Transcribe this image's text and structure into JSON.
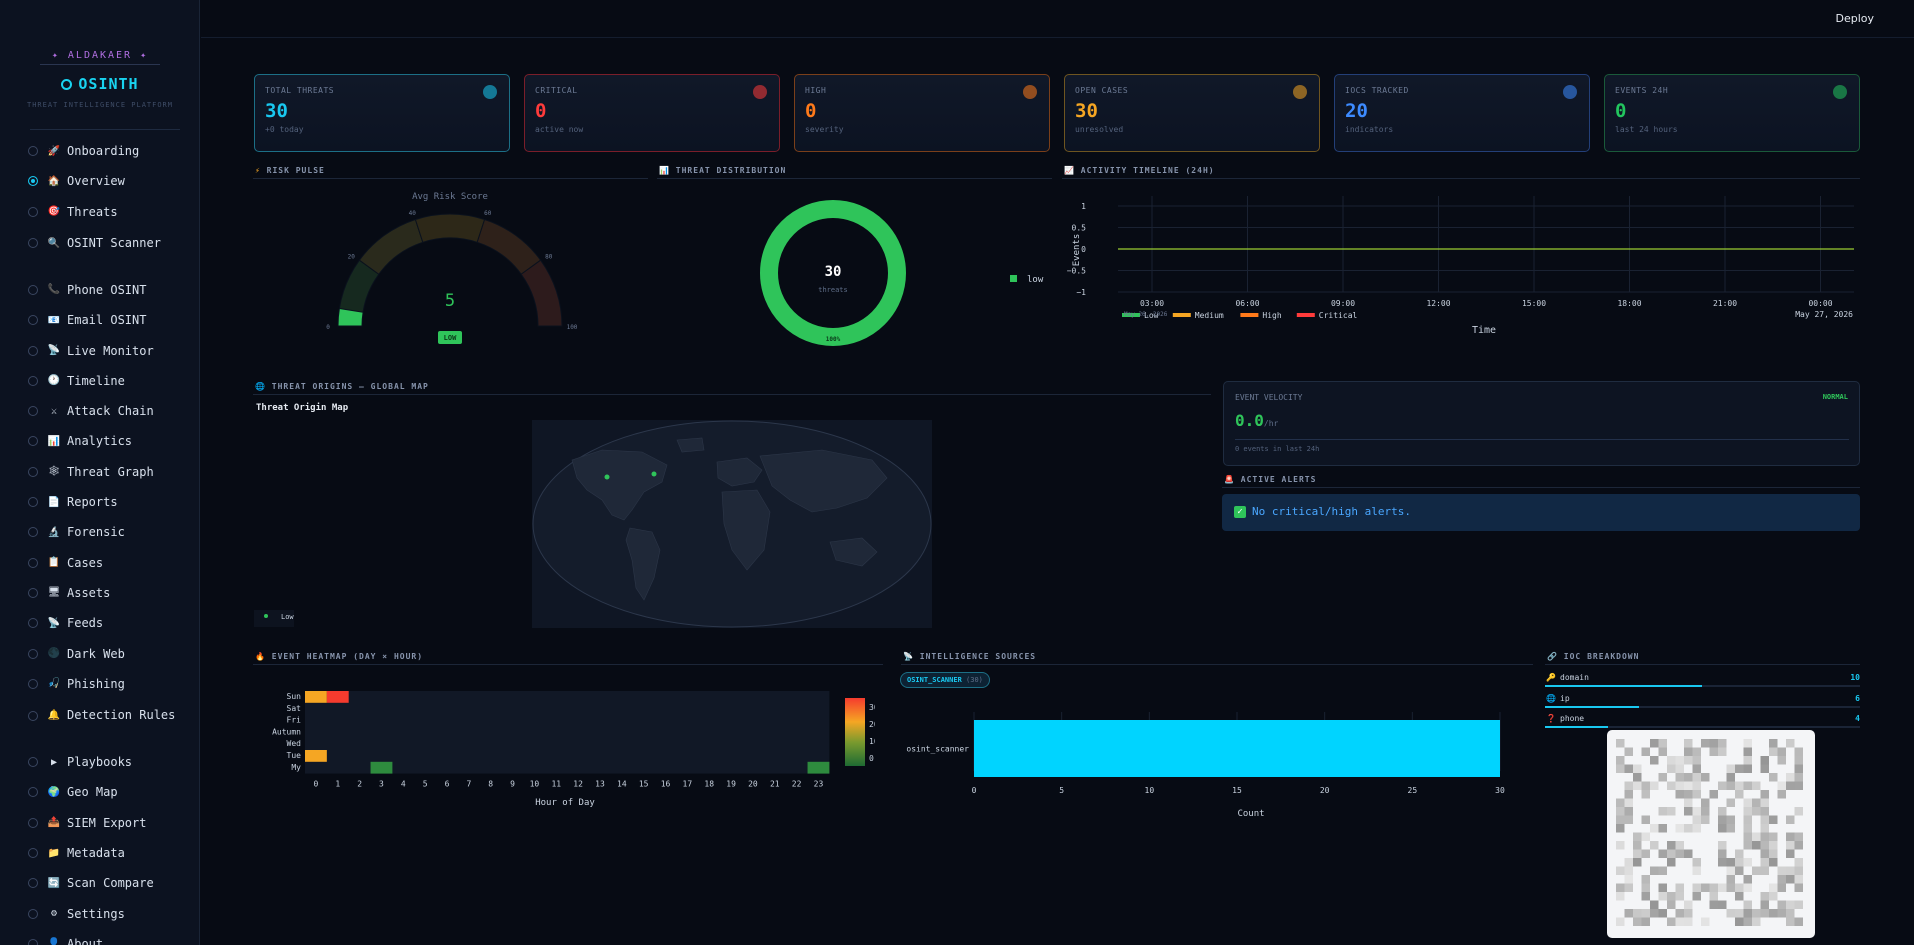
{
  "brand": {
    "tag": "✦ ALDAKAER ✦",
    "name": "OSINTH",
    "subtitle": "THREAT INTELLIGENCE PLATFORM"
  },
  "topbar": {
    "deploy": "Deploy"
  },
  "nav": [
    {
      "label": "Onboarding",
      "icon": "🚀"
    },
    {
      "label": "Overview",
      "icon": "🏠",
      "active": true
    },
    {
      "label": "Threats",
      "icon": "🎯"
    },
    {
      "label": "OSINT Scanner",
      "icon": "🔍"
    },
    {
      "label": "Phone OSINT",
      "icon": "📞"
    },
    {
      "label": "Email OSINT",
      "icon": "📧"
    },
    {
      "label": "Live Monitor",
      "icon": "📡"
    },
    {
      "label": "Timeline",
      "icon": "🕐"
    },
    {
      "label": "Attack Chain",
      "icon": "⚔"
    },
    {
      "label": "Analytics",
      "icon": "📊"
    },
    {
      "label": "Threat Graph",
      "icon": "🕸"
    },
    {
      "label": "Reports",
      "icon": "📄"
    },
    {
      "label": "Forensic",
      "icon": "🔬"
    },
    {
      "label": "Cases",
      "icon": "📋"
    },
    {
      "label": "Assets",
      "icon": "🖥"
    },
    {
      "label": "Feeds",
      "icon": "📡"
    },
    {
      "label": "Dark Web",
      "icon": "🌑"
    },
    {
      "label": "Phishing",
      "icon": "🎣"
    },
    {
      "label": "Detection Rules",
      "icon": "🔔"
    },
    {
      "label": "Playbooks",
      "icon": "▶"
    },
    {
      "label": "Geo Map",
      "icon": "🌍"
    },
    {
      "label": "SIEM Export",
      "icon": "📤"
    },
    {
      "label": "Metadata",
      "icon": "📁"
    },
    {
      "label": "Scan Compare",
      "icon": "🔄"
    },
    {
      "label": "Settings",
      "icon": "⚙"
    },
    {
      "label": "About",
      "icon": "👤"
    }
  ],
  "kpis": [
    {
      "label": "TOTAL THREATS",
      "value": "30",
      "sub": "+0 today",
      "color": "#19c8f0",
      "border": "#1c6f86"
    },
    {
      "label": "CRITICAL",
      "value": "0",
      "sub": "active now",
      "color": "#ff3b3b",
      "border": "#7a1e2a"
    },
    {
      "label": "HIGH",
      "value": "0",
      "sub": "severity",
      "color": "#ff7a1a",
      "border": "#7a3f1a"
    },
    {
      "label": "OPEN CASES",
      "value": "30",
      "sub": "unresolved",
      "color": "#f5a623",
      "border": "#6e5520"
    },
    {
      "label": "IOCS TRACKED",
      "value": "20",
      "sub": "indicators",
      "color": "#3d8bff",
      "border": "#233f78"
    },
    {
      "label": "EVENTS 24H",
      "value": "0",
      "sub": "last 24 hours",
      "color": "#22c55e",
      "border": "#1a5a3a"
    }
  ],
  "sections": {
    "risk_pulse": "RISK PULSE",
    "threat_distribution": "THREAT DISTRIBUTION",
    "activity_timeline": "ACTIVITY TIMELINE (24H)",
    "threat_origins": "THREAT ORIGINS — GLOBAL MAP",
    "active_alerts": "ACTIVE ALERTS",
    "event_heatmap": "EVENT HEATMAP (DAY × HOUR)",
    "intel_sources": "INTELLIGENCE SOURCES",
    "ioc_breakdown": "IOC BREAKDOWN"
  },
  "gauge": {
    "title": "Avg Risk Score",
    "value": 5,
    "badge": "LOW",
    "ticks": [
      "0",
      "20",
      "40",
      "60",
      "80",
      "100"
    ]
  },
  "donut": {
    "center_value": "30",
    "center_label": "threats",
    "pct_label": "100%",
    "legend": "low",
    "color": "#2fc45a"
  },
  "timeline": {
    "ylabel": "Events",
    "xlabel": "Time",
    "yticks": [
      "1",
      "0.5",
      "0",
      "−0.5",
      "−1"
    ],
    "xticks": [
      "03:00",
      "06:00",
      "09:00",
      "12:00",
      "15:00",
      "18:00",
      "21:00",
      "00:00"
    ],
    "date_left": "May 26, 2026",
    "date_right": "May 27, 2026",
    "legend": [
      "Low",
      "Medium",
      "High",
      "Critical"
    ]
  },
  "map": {
    "title": "Threat Origin Map",
    "legend": "Low"
  },
  "velocity": {
    "label": "EVENT VELOCITY",
    "status": "NORMAL",
    "value": "0.0",
    "unit": "/hr",
    "sub": "0 events in last 24h"
  },
  "alerts": {
    "message": "No critical/high alerts."
  },
  "chart_data": [
    {
      "type": "heatmap",
      "xlabel": "Hour of Day",
      "rows": [
        "Sun",
        "Sat",
        "Fri",
        "Autumn",
        "Wed",
        "Tue",
        "My"
      ],
      "x": [
        0,
        1,
        2,
        3,
        4,
        5,
        6,
        7,
        8,
        9,
        10,
        11,
        12,
        13,
        14,
        15,
        16,
        17,
        18,
        19,
        20,
        21,
        22,
        23
      ],
      "cells": [
        {
          "row": "Sun",
          "hour": 0,
          "value": 20
        },
        {
          "row": "Sun",
          "hour": 1,
          "value": 30
        },
        {
          "row": "Tue",
          "hour": 0,
          "value": 20
        },
        {
          "row": "My",
          "hour": 3,
          "value": 5
        },
        {
          "row": "My",
          "hour": 23,
          "value": 5
        }
      ],
      "colorbar_ticks": [
        "30",
        "20",
        "10",
        "0"
      ]
    },
    {
      "type": "bar",
      "orientation": "horizontal",
      "categories": [
        "osint_scanner"
      ],
      "values": [
        30
      ],
      "xlabel": "Count",
      "xlim": [
        0,
        30
      ],
      "xticks": [
        "0",
        "5",
        "10",
        "15",
        "20",
        "25",
        "30"
      ],
      "badge": "OSINT_SCANNER",
      "badge_count": "(30)"
    },
    {
      "type": "bar",
      "orientation": "horizontal",
      "categories": [
        "domain",
        "ip",
        "phone"
      ],
      "values": [
        10,
        6,
        4
      ],
      "icons": [
        "🔑",
        "🌐",
        "❓"
      ]
    }
  ]
}
